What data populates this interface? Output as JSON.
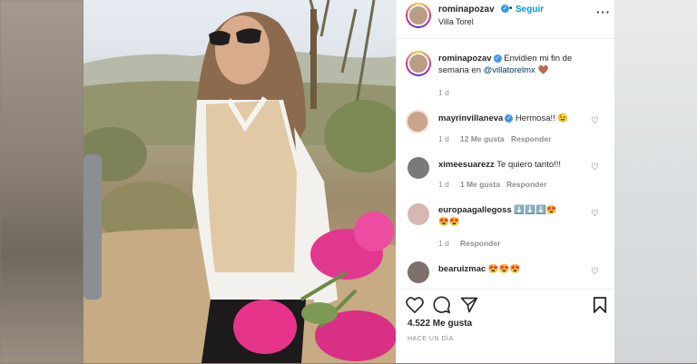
{
  "post": {
    "username": "rominapozav",
    "location": "Villa Torel",
    "follow_label": "Seguir",
    "caption_user": "rominapozav",
    "caption_text": "Envidien mi fin de semana en",
    "caption_mention": "@villatorelmx",
    "caption_emoji": "🤎",
    "caption_time": "1 d"
  },
  "comments": [
    {
      "user": "mayrinvillaneva",
      "verified": true,
      "text": "Hermosa!! 😉",
      "time": "1 d",
      "likes": "12 Me gusta",
      "reply": "Responder"
    },
    {
      "user": "ximeesuarezz",
      "verified": false,
      "text": "Te quiero tanto!!!",
      "time": "1 d",
      "likes": "1 Me gusta",
      "reply": "Responder"
    },
    {
      "user": "europaagallegoss",
      "verified": false,
      "text": "⬇️⬇️⬇️😍",
      "text2": "😍😍",
      "time": "1 d",
      "reply": "Responder"
    },
    {
      "user": "bearuizmac",
      "verified": false,
      "text": "😍😍😍"
    }
  ],
  "footer": {
    "likes": "4.522 Me gusta",
    "timestamp": "HACE UN DÍA"
  },
  "icons": {
    "more": "more-dots-icon",
    "like": "heart-icon",
    "comment": "comment-icon",
    "share": "paper-plane-icon",
    "save": "bookmark-icon",
    "verified": "verified-badge-icon"
  },
  "colors": {
    "verified": "#3897f0",
    "follow": "#0095f6",
    "mention": "#00376b"
  }
}
